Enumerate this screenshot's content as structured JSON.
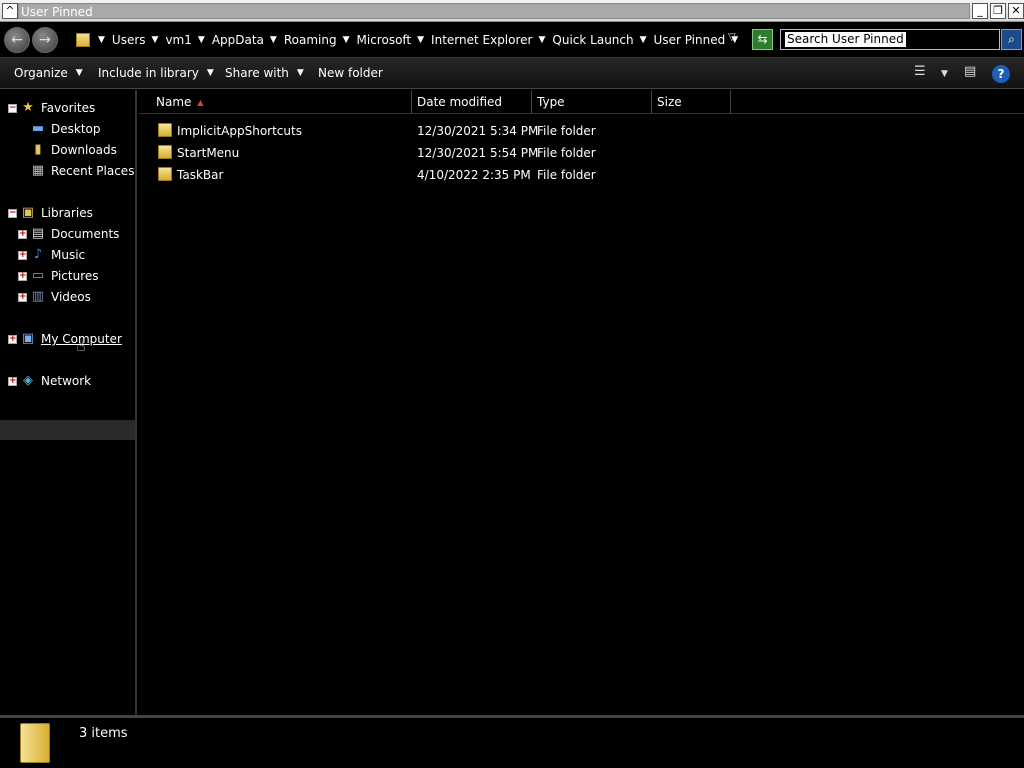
{
  "window": {
    "title": "User Pinned"
  },
  "address": {
    "path": [
      {
        "label": "Users"
      },
      {
        "label": "vm1"
      },
      {
        "label": "AppData"
      },
      {
        "label": "Roaming"
      },
      {
        "label": "Microsoft"
      },
      {
        "label": "Internet Explorer"
      },
      {
        "label": "Quick Launch"
      },
      {
        "label": "User Pinned"
      }
    ],
    "search_text": "Search User Pinned"
  },
  "toolbar": {
    "organize": "Organize",
    "include_in_library": "Include in library",
    "share_with": "Share with",
    "new_folder": "New folder"
  },
  "nav": {
    "favorites": "Favorites",
    "desktop": "Desktop",
    "downloads": "Downloads",
    "recent_places": "Recent Places",
    "libraries": "Libraries",
    "documents": "Documents",
    "music": "Music",
    "pictures": "Pictures",
    "videos": "Videos",
    "my_computer": "My Computer",
    "network": "Network"
  },
  "columns": {
    "name": "Name",
    "date_modified": "Date modified",
    "type": "Type",
    "size": "Size"
  },
  "files": [
    {
      "name": "ImplicitAppShortcuts",
      "date": "12/30/2021 5:34 PM",
      "type": "File folder",
      "size": ""
    },
    {
      "name": "StartMenu",
      "date": "12/30/2021 5:54 PM",
      "type": "File folder",
      "size": ""
    },
    {
      "name": "TaskBar",
      "date": "4/10/2022 2:35 PM",
      "type": "File folder",
      "size": ""
    }
  ],
  "status": {
    "count": "3 items"
  },
  "colors": {
    "background": "#000000",
    "text": "#ffffff",
    "folder": "#d6ae2f"
  }
}
